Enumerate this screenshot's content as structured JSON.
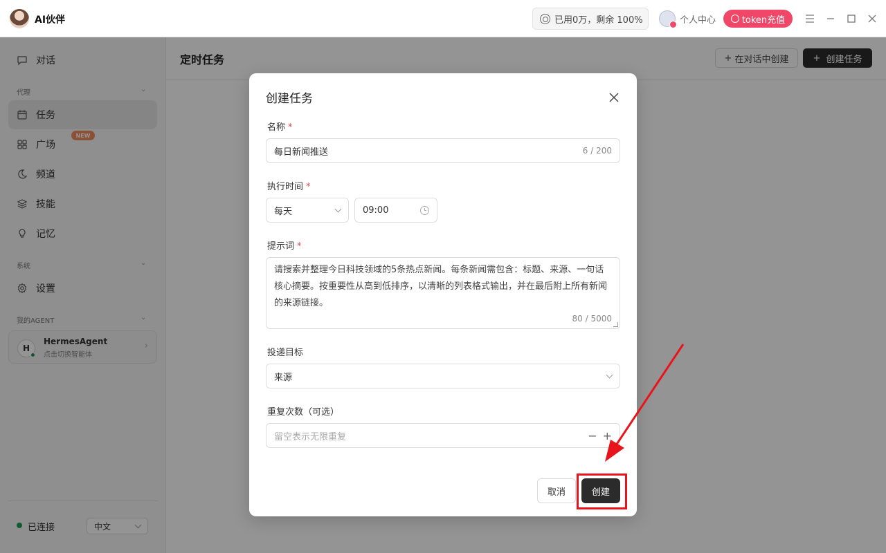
{
  "app": {
    "title": "AI伙伴"
  },
  "header": {
    "usage": "已用0万，剩余 100%",
    "user_center": "个人中心",
    "topup": "token充值",
    "icons": [
      "menu-icon",
      "minimize-icon",
      "maximize-icon",
      "close-icon"
    ]
  },
  "sidebar": {
    "chat": "对话",
    "section_agent": "代理",
    "tasks": "任务",
    "plaza": "广场",
    "plaza_badge": "NEW",
    "channel": "频道",
    "skills": "技能",
    "memory": "记忆",
    "section_system": "系统",
    "settings": "设置",
    "section_my_agent": "我的AGENT",
    "agent": {
      "initial": "H",
      "name": "HermesAgent",
      "subtitle": "点击切换智能体"
    },
    "status": "已连接",
    "language": "中文"
  },
  "main": {
    "title": "定时任务",
    "create_in_chat": "在对话中创建",
    "create_task": "创建任务"
  },
  "modal": {
    "title": "创建任务",
    "name_label": "名称",
    "name_value": "每日新闻推送",
    "name_count": "6 / 200",
    "time_label": "执行时间",
    "frequency": "每天",
    "time": "09:00",
    "prompt_label": "提示词",
    "prompt_value": "请搜索并整理今日科技领域的5条热点新闻。每条新闻需包含：标题、来源、一句话核心摘要。按重要性从高到低排序，以清晰的列表格式输出，并在最后附上所有新闻的来源链接。",
    "prompt_count": "80 / 5000",
    "target_label": "投递目标",
    "target_value": "来源",
    "repeat_label": "重复次数（可选）",
    "repeat_placeholder": "留空表示无限重复",
    "cancel": "取消",
    "submit": "创建"
  },
  "colors": {
    "accent_dark": "#2b2b2b",
    "topup_pink": "#f04668",
    "required_red": "#e5484d",
    "annotation_red": "#e8141c",
    "connected_green": "#1f9d55"
  }
}
